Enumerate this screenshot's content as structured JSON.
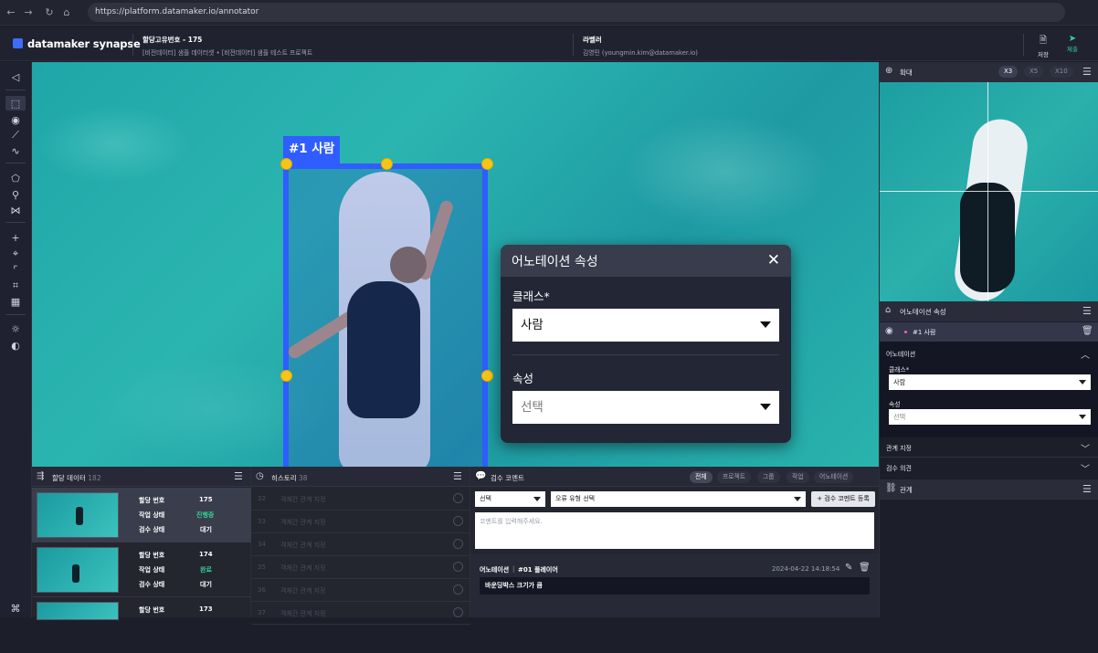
{
  "browser": {
    "url": "https://platform.datamaker.io/annotator"
  },
  "app": {
    "logo": "datamaker synapse"
  },
  "header": {
    "assign_label": "할당고유번호 - 175",
    "assign_sub": "[비전데이터] 샘플 데이터셋 • [비전데이터] 샘플 테스트 프로젝트",
    "labeler_label": "라벨러",
    "labeler_name": "김영민 (youngmin.kim@datamaker.io)",
    "save": "저장",
    "submit": "제출"
  },
  "canvas": {
    "bbox_tag": "#1  사람",
    "popup": {
      "title": "어노테이션 속성",
      "class_label": "클래스*",
      "class_value": "사람",
      "attr_label": "속성",
      "attr_placeholder": "선택"
    }
  },
  "zoom": {
    "title": "확대",
    "levels": [
      "X3",
      "X5",
      "X10"
    ],
    "active": "X3"
  },
  "props": {
    "title": "어노테이션 속성",
    "item": "#1 사람",
    "section": "어노테이션",
    "class_label": "클래스*",
    "class_value": "사람",
    "attr_label": "속성",
    "attr_value": "선택",
    "relation_assign": "관계 지정",
    "review_opinion": "검수 의견",
    "relation": "관계"
  },
  "assign": {
    "title": "할당 데이터",
    "count": "182",
    "cards": [
      {
        "k1": "할당 번호",
        "v1": "175",
        "k2": "작업 상태",
        "v2": "진행중",
        "k3": "검수 상태",
        "v3": "대기"
      },
      {
        "k1": "할당 번호",
        "v1": "174",
        "k2": "작업 상태",
        "v2": "완료",
        "k3": "검수 상태",
        "v3": "대기"
      },
      {
        "k1": "할당 번호",
        "v1": "173"
      }
    ]
  },
  "history": {
    "title": "히스토리",
    "count": "38",
    "rows": [
      {
        "num": "32",
        "text": "객체간 관계 지정"
      },
      {
        "num": "33",
        "text": "객체간 관계 지정"
      },
      {
        "num": "34",
        "text": "객체간 관계 지정"
      },
      {
        "num": "35",
        "text": "객체간 관계 지정"
      },
      {
        "num": "36",
        "text": "객체간 관계 지정"
      },
      {
        "num": "37",
        "text": "객체간 관계 지정"
      }
    ]
  },
  "comments": {
    "title": "검수 코멘트",
    "filters": [
      "전체",
      "프로젝트",
      "그룹",
      "작업",
      "어노테이션"
    ],
    "select1": "선택",
    "select2": "오류 유형 선택",
    "register": "+ 검수 코멘트 등록",
    "placeholder": "코멘트를 입력해주세요.",
    "entry_type": "어노테이션",
    "entry_target": "#01 플레이어",
    "entry_time": "2024-04-22 14:18:54",
    "entry_text": "바운딩박스 크기가 큼"
  }
}
